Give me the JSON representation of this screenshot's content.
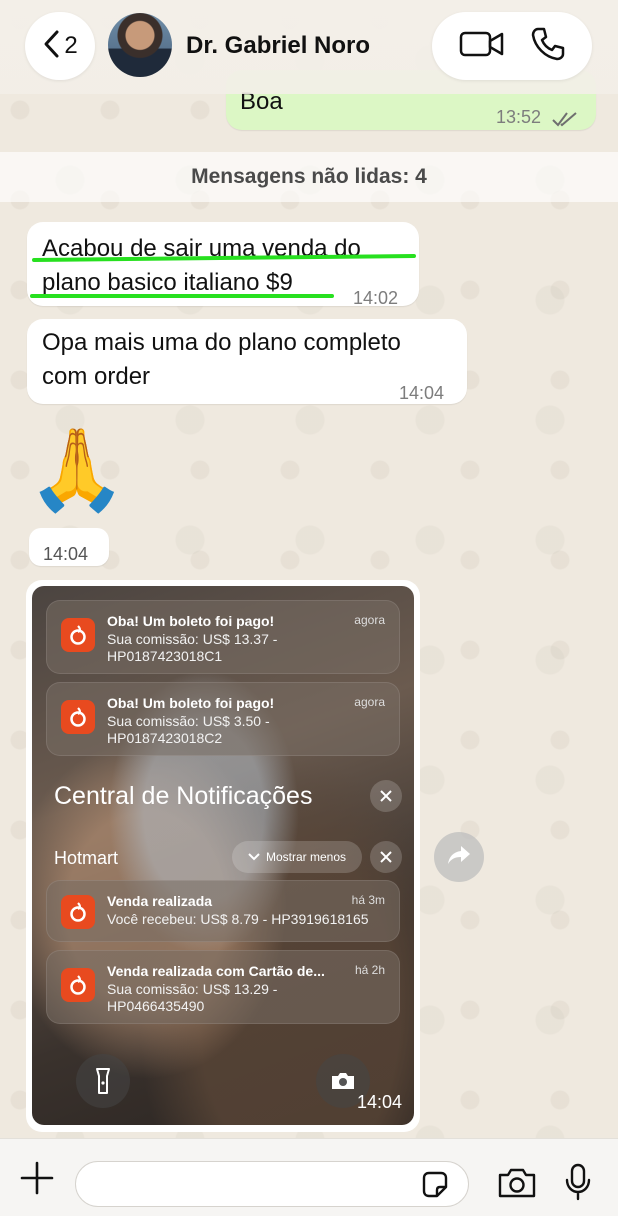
{
  "header": {
    "back_count": "2",
    "contact_name": "Dr. Gabriel Noro"
  },
  "prev_message": {
    "text": "Boa",
    "time": "13:52"
  },
  "unread_banner": "Mensagens não lidas: 4",
  "messages": [
    {
      "lines": [
        "Acabou de sair uma venda do",
        "plano basico italiano $9"
      ],
      "time": "14:02"
    },
    {
      "lines": [
        "Opa mais uma do plano completo",
        "com order"
      ],
      "time": "14:04"
    },
    {
      "emoji": "🙏",
      "time": "14:04"
    }
  ],
  "image_message": {
    "time": "14:04",
    "notifications_top": [
      {
        "title": "Oba! Um boleto foi pago!",
        "body": "Sua comissão: US$ 13.37 - HP0187423018C1",
        "time": "agora"
      },
      {
        "title": "Oba! Um boleto foi pago!",
        "body": "Sua comissão: US$ 3.50 - HP0187423018C2",
        "time": "agora"
      }
    ],
    "center_title": "Central de Notificações",
    "group_name": "Hotmart",
    "show_less": "Mostrar menos",
    "notifications_group": [
      {
        "title": "Venda realizada",
        "body": "Você recebeu: US$ 8.79 - HP3919618165",
        "time": "há 3m"
      },
      {
        "title": "Venda realizada com Cartão de...",
        "body": "Sua comissão: US$ 13.29 - HP0466435490",
        "time": "há 2h"
      }
    ]
  },
  "composer": {
    "placeholder": ""
  },
  "colors": {
    "outgoing_bubble": "#dcf7c5",
    "highlight": "#27e01f",
    "hotmart": "#e84a1f"
  }
}
